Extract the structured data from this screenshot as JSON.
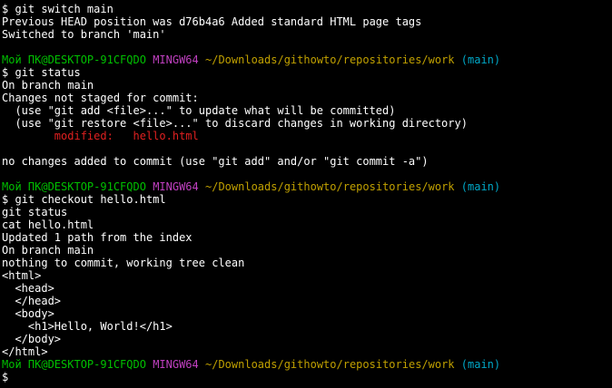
{
  "colors": {
    "background": "#000000",
    "default": "#ffffff",
    "prompt_user": "#00c000",
    "prompt_shell": "#c040c0",
    "prompt_path": "#c0a000",
    "prompt_branch": "#00a8c8",
    "modified": "#e02020"
  },
  "terminal": {
    "lines": [
      [
        {
          "text": "$ git switch main",
          "color": "default"
        }
      ],
      [
        {
          "text": "Previous HEAD position was d76b4a6 Added standard HTML page tags",
          "color": "default"
        }
      ],
      [
        {
          "text": "Switched to branch 'main'",
          "color": "default"
        }
      ],
      [
        {
          "text": "",
          "color": "default"
        }
      ],
      [
        {
          "text": "Мой ПК@DESKTOP-91CFQDO",
          "color": "prompt_user"
        },
        {
          "text": " ",
          "color": "default"
        },
        {
          "text": "MINGW64",
          "color": "prompt_shell"
        },
        {
          "text": " ",
          "color": "default"
        },
        {
          "text": "~/Downloads/githowto/repositories/work",
          "color": "prompt_path"
        },
        {
          "text": " ",
          "color": "default"
        },
        {
          "text": "(main)",
          "color": "prompt_branch"
        }
      ],
      [
        {
          "text": "$ git status",
          "color": "default"
        }
      ],
      [
        {
          "text": "On branch main",
          "color": "default"
        }
      ],
      [
        {
          "text": "Changes not staged for commit:",
          "color": "default"
        }
      ],
      [
        {
          "text": "  (use \"git add <file>...\" to update what will be committed)",
          "color": "default"
        }
      ],
      [
        {
          "text": "  (use \"git restore <file>...\" to discard changes in working directory)",
          "color": "default"
        }
      ],
      [
        {
          "text": "        modified:   hello.html",
          "color": "modified"
        }
      ],
      [
        {
          "text": "",
          "color": "default"
        }
      ],
      [
        {
          "text": "no changes added to commit (use \"git add\" and/or \"git commit -a\")",
          "color": "default"
        }
      ],
      [
        {
          "text": "",
          "color": "default"
        }
      ],
      [
        {
          "text": "Мой ПК@DESKTOP-91CFQDO",
          "color": "prompt_user"
        },
        {
          "text": " ",
          "color": "default"
        },
        {
          "text": "MINGW64",
          "color": "prompt_shell"
        },
        {
          "text": " ",
          "color": "default"
        },
        {
          "text": "~/Downloads/githowto/repositories/work",
          "color": "prompt_path"
        },
        {
          "text": " ",
          "color": "default"
        },
        {
          "text": "(main)",
          "color": "prompt_branch"
        }
      ],
      [
        {
          "text": "$ git checkout hello.html",
          "color": "default"
        }
      ],
      [
        {
          "text": "git status",
          "color": "default"
        }
      ],
      [
        {
          "text": "cat hello.html",
          "color": "default"
        }
      ],
      [
        {
          "text": "Updated 1 path from the index",
          "color": "default"
        }
      ],
      [
        {
          "text": "On branch main",
          "color": "default"
        }
      ],
      [
        {
          "text": "nothing to commit, working tree clean",
          "color": "default"
        }
      ],
      [
        {
          "text": "<html>",
          "color": "default"
        }
      ],
      [
        {
          "text": "  <head>",
          "color": "default"
        }
      ],
      [
        {
          "text": "  </head>",
          "color": "default"
        }
      ],
      [
        {
          "text": "  <body>",
          "color": "default"
        }
      ],
      [
        {
          "text": "    <h1>Hello, World!</h1>",
          "color": "default"
        }
      ],
      [
        {
          "text": "  </body>",
          "color": "default"
        }
      ],
      [
        {
          "text": "</html>",
          "color": "default"
        }
      ],
      [
        {
          "text": "Мой ПК@DESKTOP-91CFQDO",
          "color": "prompt_user"
        },
        {
          "text": " ",
          "color": "default"
        },
        {
          "text": "MINGW64",
          "color": "prompt_shell"
        },
        {
          "text": " ",
          "color": "default"
        },
        {
          "text": "~/Downloads/githowto/repositories/work",
          "color": "prompt_path"
        },
        {
          "text": " ",
          "color": "default"
        },
        {
          "text": "(main)",
          "color": "prompt_branch"
        }
      ],
      [
        {
          "text": "$",
          "color": "default"
        }
      ]
    ]
  }
}
